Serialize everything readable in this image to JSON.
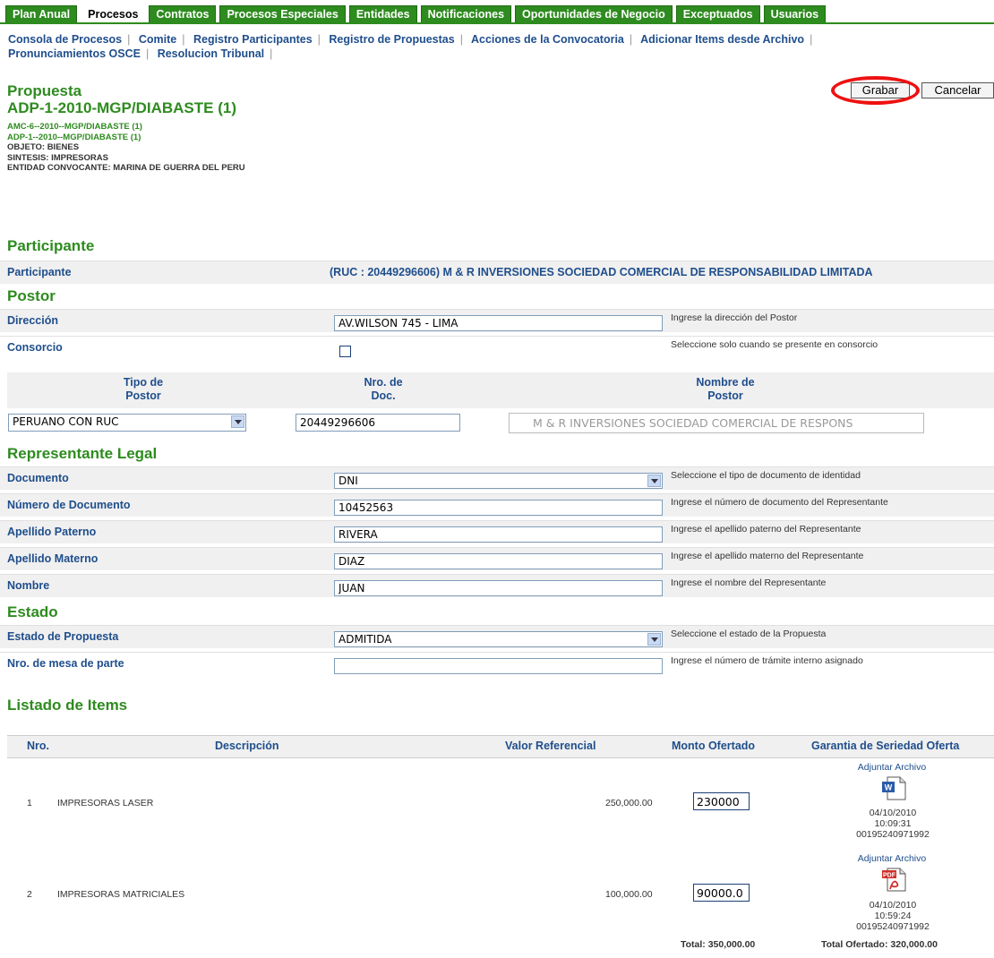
{
  "tabs": [
    "Plan Anual",
    "Procesos",
    "Contratos",
    "Procesos Especiales",
    "Entidades",
    "Notificaciones",
    "Oportunidades de Negocio",
    "Exceptuados",
    "Usuarios"
  ],
  "active_tab": "Procesos",
  "subnav": {
    "row1": [
      "Consola de Procesos",
      "Comite",
      "Registro Participantes",
      "Registro de Propuestas",
      "Acciones de la Convocatoria",
      "Adicionar Items desde Archivo"
    ],
    "row2": [
      "Pronunciamientos OSCE",
      "Resolucion Tribunal"
    ]
  },
  "header": {
    "title": "Propuesta",
    "code": "ADP-1-2010-MGP/DIABASTE (1)",
    "line1": "AMC-6--2010--MGP/DIABASTE (1)",
    "line2": "ADP-1--2010--MGP/DIABASTE (1)",
    "objeto": "OBJETO: BIENES",
    "sintesis": "SINTESIS: IMPRESORAS",
    "entidad": "ENTIDAD CONVOCANTE: MARINA DE GUERRA DEL PERU"
  },
  "buttons": {
    "grabar": "Grabar",
    "cancelar": "Cancelar"
  },
  "participante": {
    "heading": "Participante",
    "label": "Participante",
    "value": "(RUC : 20449296606) M & R INVERSIONES SOCIEDAD COMERCIAL DE RESPONSABILIDAD LIMITADA"
  },
  "postor": {
    "heading": "Postor",
    "direccion_label": "Dirección",
    "direccion_value": "AV.WILSON 745 - LIMA",
    "direccion_hint": "Ingrese la dirección del Postor",
    "consorcio_label": "Consorcio",
    "consorcio_hint": "Seleccione solo cuando se presente en consorcio",
    "col_tipo_1": "Tipo de",
    "col_tipo_2": "Postor",
    "col_doc_1": "Nro. de",
    "col_doc_2": "Doc.",
    "col_nombre_1": "Nombre de",
    "col_nombre_2": "Postor",
    "tipo_value": "PERUANO CON RUC",
    "doc_value": "20449296606",
    "nombre_value": "M & R INVERSIONES SOCIEDAD COMERCIAL DE RESPONS"
  },
  "representante": {
    "heading": "Representante Legal",
    "documento_label": "Documento",
    "documento_value": "DNI",
    "documento_hint": "Seleccione el tipo de documento de identidad",
    "numero_label": "Número de Documento",
    "numero_value": "10452563",
    "numero_hint": "Ingrese el número de documento del Representante",
    "paterno_label": "Apellido Paterno",
    "paterno_value": "RIVERA",
    "paterno_hint": "Ingrese el apellido paterno del Representante",
    "materno_label": "Apellido Materno",
    "materno_value": "DIAZ",
    "materno_hint": "Ingrese el apellido materno del Representante",
    "nombre_label": "Nombre",
    "nombre_value": "JUAN",
    "nombre_hint": "Ingrese el nombre del Representante"
  },
  "estado": {
    "heading": "Estado",
    "estado_label": "Estado de Propuesta",
    "estado_value": "ADMITIDA",
    "estado_hint": "Seleccione el estado de la Propuesta",
    "mesa_label": "Nro. de mesa de parte",
    "mesa_value": "",
    "mesa_hint": "Ingrese el número de trámite interno asignado"
  },
  "items": {
    "heading": "Listado de Items",
    "headers": [
      "Nro.",
      "Descripción",
      "Valor Referencial",
      "Monto Ofertado",
      "Garantia de Seriedad Oferta"
    ],
    "rows": [
      {
        "nro": "1",
        "desc": "IMPRESORAS LASER",
        "valor": "250,000.00",
        "monto": "230000",
        "link": "Adjuntar Archivo",
        "icon": "word-doc-icon",
        "date": "04/10/2010",
        "time": "10:09:31",
        "code": "00195240971992"
      },
      {
        "nro": "2",
        "desc": "IMPRESORAS MATRICIALES",
        "valor": "100,000.00",
        "monto": "90000.0",
        "link": "Adjuntar Archivo",
        "icon": "pdf-doc-icon",
        "date": "04/10/2010",
        "time": "10:59:24",
        "code": "00195240971992"
      }
    ],
    "total": "Total: 350,000.00",
    "total_ofertado": "Total Ofertado: 320,000.00"
  }
}
